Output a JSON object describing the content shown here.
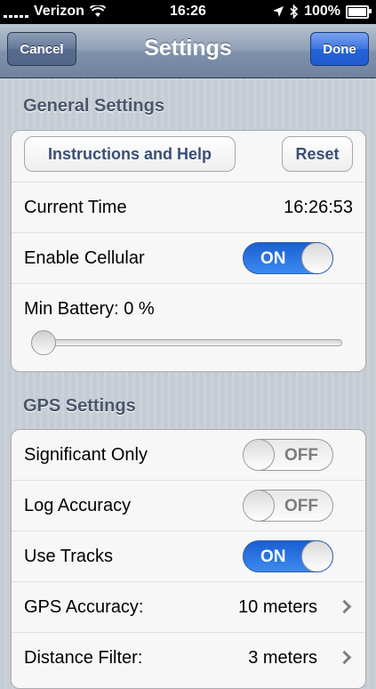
{
  "status_bar": {
    "carrier": "Verizon",
    "time": "16:26",
    "battery": "100%",
    "icons": [
      "signal-icon",
      "wifi-icon",
      "location-icon",
      "bluetooth-icon",
      "battery-icon"
    ]
  },
  "navbar": {
    "title": "Settings",
    "cancel_label": "Cancel",
    "done_label": "Done"
  },
  "general": {
    "header": "General Settings",
    "instructions_label": "Instructions and Help",
    "reset_label": "Reset",
    "current_time_label": "Current Time",
    "current_time_value": "16:26:53",
    "enable_cellular_label": "Enable Cellular",
    "enable_cellular_state": "ON",
    "min_battery_label": "Min Battery: 0 %",
    "min_battery_value": 0
  },
  "gps": {
    "header": "GPS Settings",
    "significant_only_label": "Significant Only",
    "significant_only_state": "OFF",
    "log_accuracy_label": "Log Accuracy",
    "log_accuracy_state": "OFF",
    "use_tracks_label": "Use Tracks",
    "use_tracks_state": "ON",
    "gps_accuracy_label": "GPS Accuracy:",
    "gps_accuracy_value": "10 meters",
    "distance_filter_label": "Distance Filter:",
    "distance_filter_value": "3 meters"
  },
  "colors": {
    "toggle_on": "#2f7be8",
    "navbar": "#8f9fb5",
    "done_button": "#2563d8",
    "section_header": "#4c566c"
  }
}
